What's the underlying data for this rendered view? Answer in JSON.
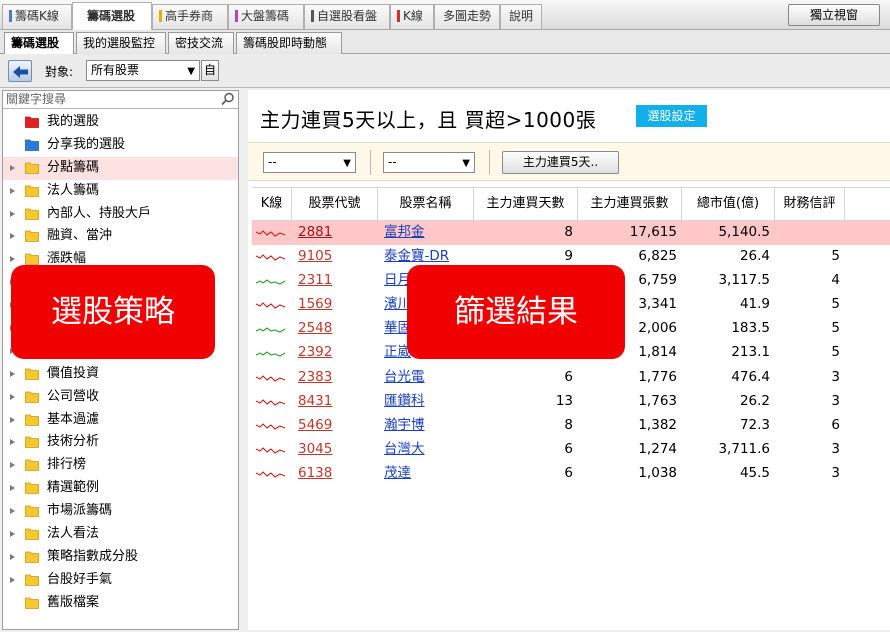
{
  "top_tabs": [
    {
      "label": "籌碼K線",
      "color": "#4a7cc9"
    },
    {
      "label": "籌碼選股",
      "color": ""
    },
    {
      "label": "高手券商",
      "color": "#e0b000"
    },
    {
      "label": "大盤籌碼",
      "color": "#c040c0"
    },
    {
      "label": "自選股看盤",
      "color": "#555555"
    },
    {
      "label": "K線",
      "color": "#d03030"
    },
    {
      "label": "多圖走勢",
      "color": ""
    },
    {
      "label": "說明",
      "color": ""
    }
  ],
  "standalone_window": "獨立視窗",
  "sub_tabs": [
    "籌碼選股",
    "我的選股監控",
    "密技交流",
    "籌碼股即時動態"
  ],
  "toolbar": {
    "target_label": "對象:",
    "target_value": "所有股票",
    "target_btn": "自"
  },
  "search": {
    "placeholder": "關鍵字搜尋"
  },
  "tree": [
    {
      "label": "我的選股",
      "folder": "red",
      "expandable": false
    },
    {
      "label": "分享我的選股",
      "folder": "blue",
      "expandable": false
    },
    {
      "label": "分點籌碼",
      "folder": "yellow",
      "expandable": true,
      "highlight": true
    },
    {
      "label": "法人籌碼",
      "folder": "yellow",
      "expandable": true
    },
    {
      "label": "內部人、持股大戶",
      "folder": "yellow",
      "expandable": true
    },
    {
      "label": "融資、當沖",
      "folder": "yellow",
      "expandable": true
    },
    {
      "label": "漲跌幅",
      "folder": "yellow",
      "expandable": true
    },
    {
      "label": "",
      "folder": "yellow",
      "expandable": true
    },
    {
      "label": "",
      "folder": "yellow",
      "expandable": true
    },
    {
      "label": "",
      "folder": "yellow",
      "expandable": true
    },
    {
      "label": "",
      "folder": "yellow",
      "expandable": true
    },
    {
      "label": "價值投資",
      "folder": "yellow",
      "expandable": true
    },
    {
      "label": "公司營收",
      "folder": "yellow",
      "expandable": true
    },
    {
      "label": "基本過濾",
      "folder": "yellow",
      "expandable": true
    },
    {
      "label": "技術分析",
      "folder": "yellow",
      "expandable": true
    },
    {
      "label": "排行榜",
      "folder": "yellow",
      "expandable": true
    },
    {
      "label": "精選範例",
      "folder": "yellow",
      "expandable": true
    },
    {
      "label": "市場派籌碼",
      "folder": "yellow",
      "expandable": true
    },
    {
      "label": "法人看法",
      "folder": "yellow",
      "expandable": true
    },
    {
      "label": "策略指數成分股",
      "folder": "yellow",
      "expandable": true
    },
    {
      "label": "台股好手氣",
      "folder": "yellow",
      "expandable": true
    },
    {
      "label": "舊版檔案",
      "folder": "yellow",
      "expandable": false
    }
  ],
  "criteria": "主力連買5天以上，且 買超>1000張",
  "setting_btn": "選股設定",
  "filters": {
    "dd1": "--",
    "dd2": "--",
    "btn": "主力連買5天.."
  },
  "columns": [
    "K線",
    "股票代號",
    "股票名稱",
    "主力連買天數",
    "主力連買張數",
    "總市值(億)",
    "財務信評"
  ],
  "rows": [
    {
      "code": "2881",
      "name": "富邦金",
      "days": "8",
      "lots": "17,615",
      "cap": "5,140.5",
      "rating": "",
      "selected": true,
      "trend": "down"
    },
    {
      "code": "9105",
      "name": "泰金寶-DR",
      "days": "9",
      "lots": "6,825",
      "cap": "26.4",
      "rating": "5",
      "trend": "down"
    },
    {
      "code": "2311",
      "name": "日月",
      "days": "",
      "lots": "6,759",
      "cap": "3,117.5",
      "rating": "4",
      "trend": "up"
    },
    {
      "code": "1569",
      "name": "濱川",
      "days": "",
      "lots": "3,341",
      "cap": "41.9",
      "rating": "5",
      "trend": "down"
    },
    {
      "code": "2548",
      "name": "華固",
      "days": "",
      "lots": "2,006",
      "cap": "183.5",
      "rating": "5",
      "trend": "up"
    },
    {
      "code": "2392",
      "name": "正崴",
      "days": "",
      "lots": "1,814",
      "cap": "213.1",
      "rating": "5",
      "trend": "up"
    },
    {
      "code": "2383",
      "name": "台光電",
      "days": "6",
      "lots": "1,776",
      "cap": "476.4",
      "rating": "3",
      "trend": "down"
    },
    {
      "code": "8431",
      "name": "匯鑽科",
      "days": "13",
      "lots": "1,763",
      "cap": "26.2",
      "rating": "3",
      "trend": "down"
    },
    {
      "code": "5469",
      "name": "瀚宇博",
      "days": "8",
      "lots": "1,382",
      "cap": "72.3",
      "rating": "6",
      "trend": "down"
    },
    {
      "code": "3045",
      "name": "台灣大",
      "days": "6",
      "lots": "1,274",
      "cap": "3,711.6",
      "rating": "3",
      "trend": "down"
    },
    {
      "code": "6138",
      "name": "茂達",
      "days": "6",
      "lots": "1,038",
      "cap": "45.5",
      "rating": "3",
      "trend": "down"
    }
  ],
  "callouts": {
    "strategy": "選股策略",
    "results": "篩選結果"
  },
  "colors": {
    "up_line": "#2e9a2e",
    "down_line": "#d22020",
    "callout": "#f00000",
    "accent": "#12b0e8"
  }
}
